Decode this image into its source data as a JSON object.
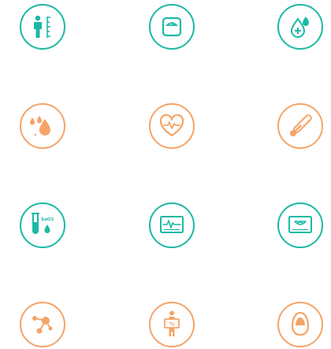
{
  "colors": {
    "teal": "#1bb9a3",
    "orange": "#f5a468"
  },
  "icons": [
    {
      "name": "height-measure-icon",
      "color": "teal"
    },
    {
      "name": "weighing-scale-icon",
      "color": "teal"
    },
    {
      "name": "blood-drop-plus-icon",
      "color": "teal"
    },
    {
      "name": "droplets-icon",
      "color": "orange"
    },
    {
      "name": "heart-pulse-icon",
      "color": "orange"
    },
    {
      "name": "thermometer-icon",
      "color": "orange"
    },
    {
      "name": "sao2-test-tube-icon",
      "color": "teal",
      "label": "SaO2"
    },
    {
      "name": "ecg-monitor-icon",
      "color": "teal"
    },
    {
      "name": "ultrasound-monitor-icon",
      "color": "teal"
    },
    {
      "name": "molecule-icon",
      "color": "orange"
    },
    {
      "name": "body-fat-percent-icon",
      "color": "orange",
      "label": "%"
    },
    {
      "name": "capsule-icon",
      "color": "orange"
    }
  ]
}
